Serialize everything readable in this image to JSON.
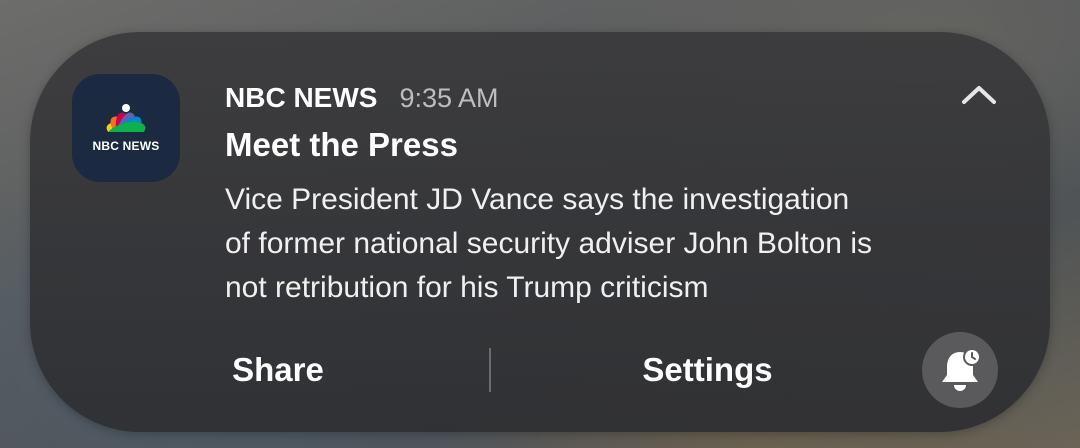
{
  "notification": {
    "app_icon": {
      "name": "nbc-peacock-icon",
      "label": "NBC NEWS",
      "feather_colors": [
        "#fccc12",
        "#f37021",
        "#cc004c",
        "#6460aa",
        "#0089d0",
        "#0db14b"
      ]
    },
    "app_name": "NBC NEWS",
    "time": "9:35 AM",
    "collapse_icon": "chevron-up-icon",
    "title": "Meet the Press",
    "body_lines": [
      "Vice President JD Vance says the investigation",
      "of former national security adviser John Bolton is",
      "not retribution for his Trump criticism"
    ],
    "actions": {
      "share_label": "Share",
      "settings_label": "Settings",
      "snooze_icon": "bell-snooze-icon"
    }
  }
}
